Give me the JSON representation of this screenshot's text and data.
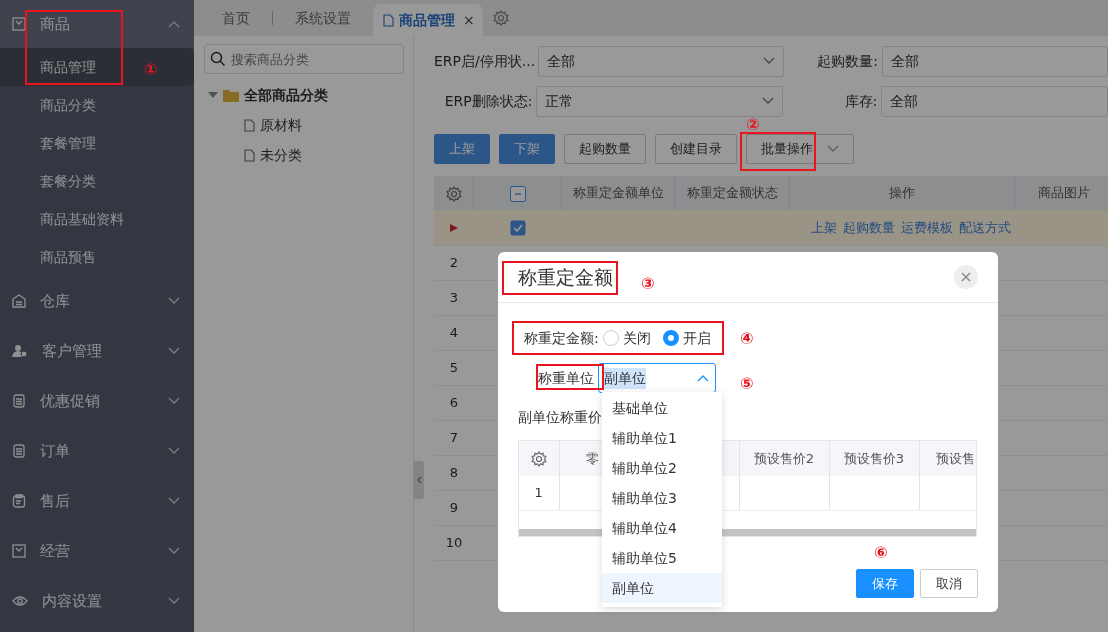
{
  "sidebar": {
    "groups": [
      {
        "label": "商品",
        "expanded": true,
        "children": [
          {
            "label": "商品管理",
            "selected": true
          },
          {
            "label": "商品分类",
            "selected": false
          },
          {
            "label": "套餐管理",
            "selected": false
          },
          {
            "label": "套餐分类",
            "selected": false
          },
          {
            "label": "商品基础资料",
            "selected": false
          },
          {
            "label": "商品预售",
            "selected": false
          }
        ]
      },
      {
        "label": "仓库",
        "expanded": false
      },
      {
        "label": "客户管理",
        "expanded": false
      },
      {
        "label": "优惠促销",
        "expanded": false
      },
      {
        "label": "订单",
        "expanded": false
      },
      {
        "label": "售后",
        "expanded": false
      },
      {
        "label": "经营",
        "expanded": false
      },
      {
        "label": "内容设置",
        "expanded": false
      }
    ]
  },
  "tabs": [
    {
      "label": "首页",
      "selected": false
    },
    {
      "label": "系统设置",
      "selected": false
    },
    {
      "label": "商品管理",
      "selected": true,
      "close": "×"
    }
  ],
  "category_tree": {
    "search": {
      "placeholder": "搜索商品分类"
    },
    "root": {
      "label": "全部商品分类",
      "expanded": true,
      "children": [
        {
          "label": "原材料"
        },
        {
          "label": "未分类"
        }
      ]
    }
  },
  "filters": [
    {
      "label": "ERP启/停用状...",
      "value": "全部"
    },
    {
      "label": "起购数量:",
      "value": "全部"
    },
    {
      "label": "ERP删除状态:",
      "value": "正常"
    },
    {
      "label": "库存:",
      "value": "全部"
    }
  ],
  "toolbar": [
    {
      "label": "上架",
      "kind": "primary"
    },
    {
      "label": "下架",
      "kind": "primary"
    },
    {
      "label": "起购数量",
      "kind": "default"
    },
    {
      "label": "创建目录",
      "kind": "default"
    },
    {
      "label": "批量操作",
      "kind": "dropdown"
    }
  ],
  "table": {
    "header_partial_check": true,
    "columns": [
      "称重定金额单位",
      "称重定金额状态",
      "操作",
      "商品图片"
    ],
    "rows": [
      {
        "selected": true,
        "checked": true,
        "actions": [
          "上架",
          "起购数量",
          "运费模板",
          "配送方式"
        ]
      },
      {
        "number": "2",
        "selected": false
      },
      {
        "number": "3",
        "selected": false
      },
      {
        "number": "4",
        "selected": false
      },
      {
        "number": "5",
        "selected": false
      },
      {
        "number": "6",
        "selected": false
      },
      {
        "number": "7",
        "selected": false
      },
      {
        "number": "8",
        "selected": false
      },
      {
        "number": "9",
        "selected": false
      },
      {
        "number": "10",
        "selected": false
      }
    ]
  },
  "dialog": {
    "title": "称重定金额",
    "close": "×",
    "weight_deposit": {
      "label": "称重定金额:",
      "options": [
        {
          "label": "关闭",
          "selected": false
        },
        {
          "label": "开启",
          "selected": true
        }
      ]
    },
    "unit": {
      "label": "称重单位",
      "value": "副单位",
      "expanded": true,
      "options": [
        {
          "label": "基础单位",
          "selected": false
        },
        {
          "label": "辅助单位1",
          "selected": false
        },
        {
          "label": "辅助单位2",
          "selected": false
        },
        {
          "label": "辅助单位3",
          "selected": false
        },
        {
          "label": "辅助单位4",
          "selected": false
        },
        {
          "label": "辅助单位5",
          "selected": false
        },
        {
          "label": "副单位",
          "selected": true
        }
      ]
    },
    "price_label": "副单位称重价",
    "price_table": {
      "columns": [
        "零",
        "预设售价2",
        "预设售价3",
        "预设售"
      ],
      "rows": [
        {
          "number": "1"
        }
      ]
    },
    "buttons": [
      {
        "label": "保存",
        "kind": "primary"
      },
      {
        "label": "取消",
        "kind": "default"
      }
    ]
  },
  "annotations": [
    {
      "label": "①",
      "framed": true
    },
    {
      "label": "②",
      "framed": true
    },
    {
      "label": "③",
      "framed": true
    },
    {
      "label": "④",
      "framed": true
    },
    {
      "label": "⑤",
      "framed": true
    },
    {
      "label": "⑥",
      "framed": false
    }
  ]
}
